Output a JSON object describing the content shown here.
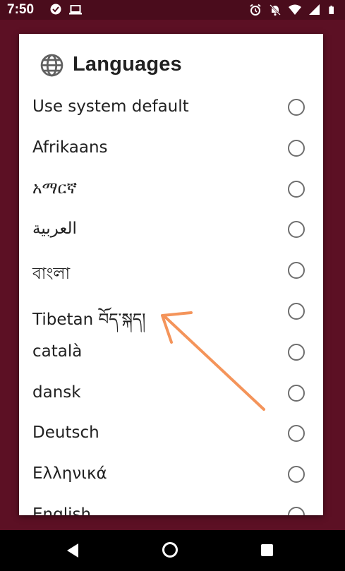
{
  "status_bar": {
    "time": "7:50",
    "left_icons": [
      "messaging-icon",
      "laptop-icon"
    ],
    "right_icons": [
      "alarm-icon",
      "do-not-disturb-off-icon",
      "wifi-icon",
      "signal-icon",
      "battery-icon"
    ]
  },
  "dialog": {
    "title": "Languages",
    "title_icon": "globe-icon",
    "items": [
      {
        "label": "Use system default",
        "selected": false
      },
      {
        "label": "Afrikaans",
        "selected": false
      },
      {
        "label": "አማርኛ",
        "selected": false
      },
      {
        "label": "العربية",
        "selected": false
      },
      {
        "label": "বাংলা",
        "selected": false
      },
      {
        "label": "Tibetan བོད་སྐད།",
        "selected": false
      },
      {
        "label": "català",
        "selected": false
      },
      {
        "label": "dansk",
        "selected": false
      },
      {
        "label": "Deutsch",
        "selected": false
      },
      {
        "label": "Ελληνικά",
        "selected": false
      },
      {
        "label": "English",
        "selected": false
      }
    ]
  },
  "annotation": {
    "type": "arrow",
    "color": "#f4945a",
    "points_to": "Tibetan བོད་སྐད།"
  },
  "nav_bar": {
    "icons": [
      "back-icon",
      "home-icon",
      "recents-icon"
    ]
  },
  "colors": {
    "background": "#5c1024",
    "status_bar": "#4a0c1c",
    "dialog": "#ffffff",
    "text": "#212121",
    "radio": "#6e6e6e"
  }
}
